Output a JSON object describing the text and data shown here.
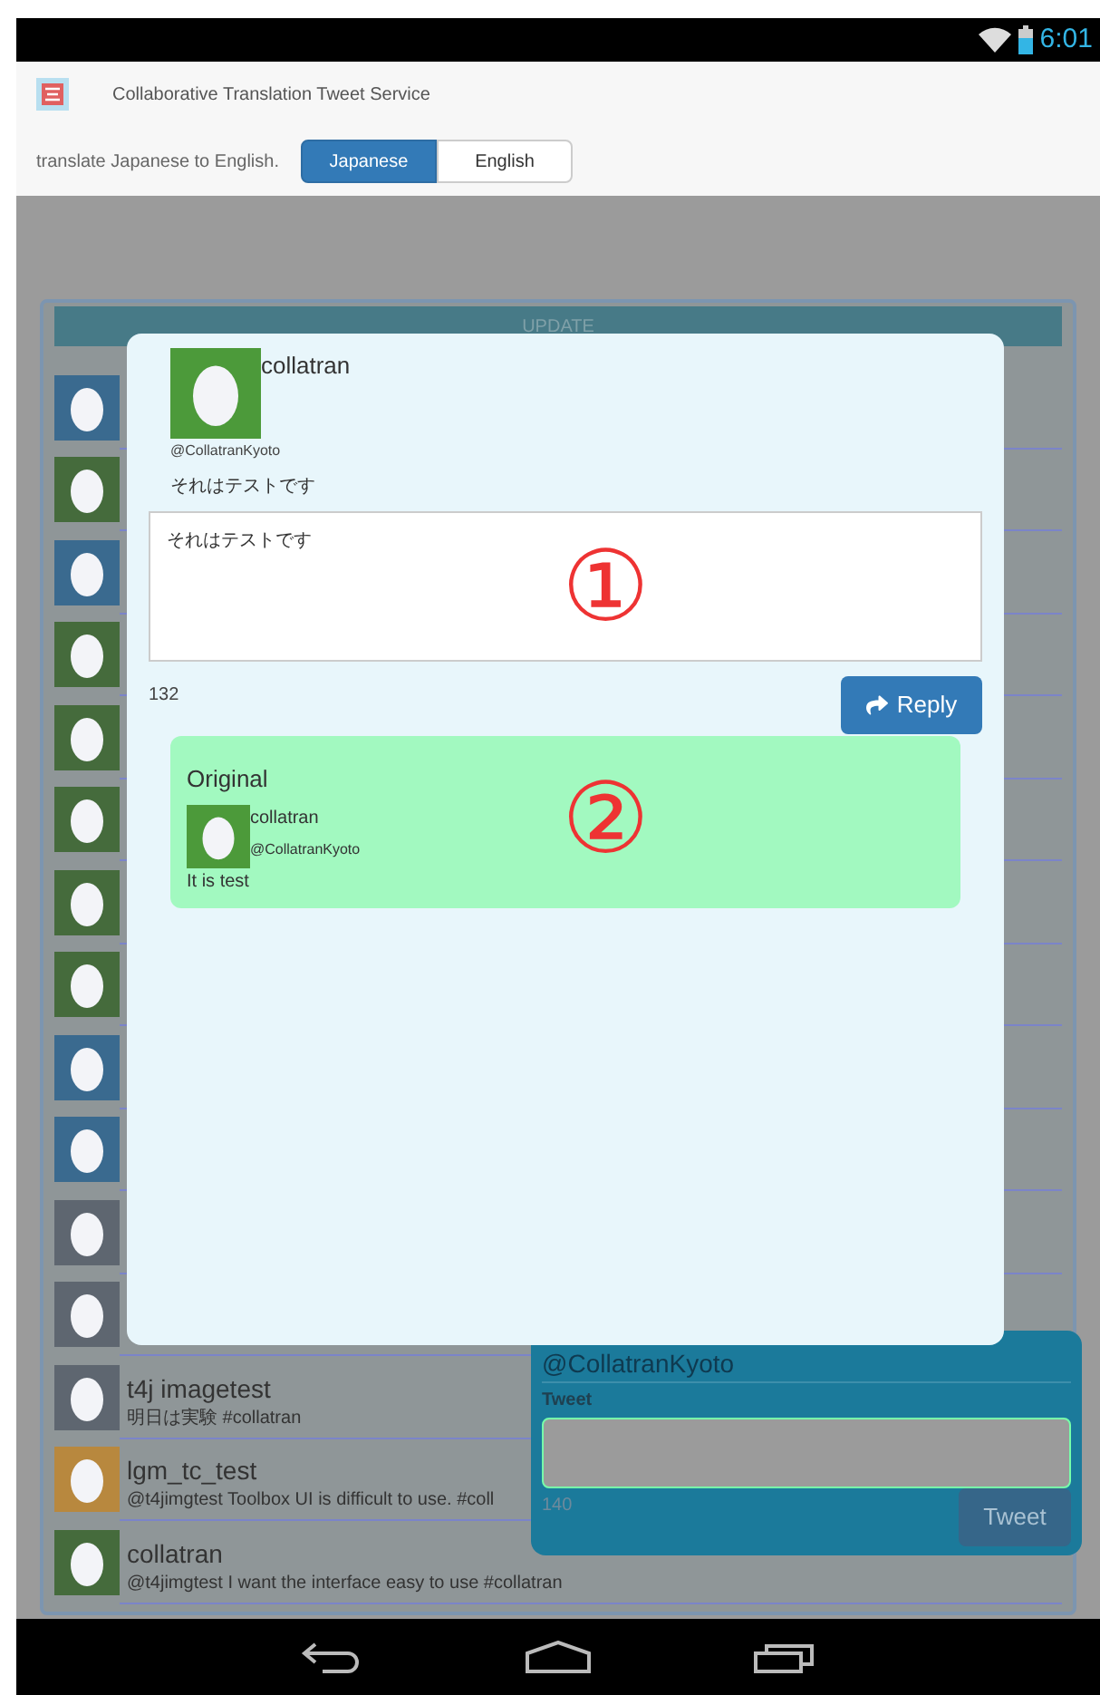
{
  "status_bar": {
    "time": "6:01"
  },
  "app": {
    "title": "Collaborative Translation Tweet Service"
  },
  "language_bar": {
    "label": "translate Japanese to English.",
    "options": [
      {
        "label": "Japanese",
        "selected": true
      },
      {
        "label": "English",
        "selected": false
      }
    ]
  },
  "timeline": {
    "update_button": "UPDATE",
    "tweets": [
      {
        "color": "#3a6a8f"
      },
      {
        "color": "#456b3c"
      },
      {
        "color": "#3a6a8f"
      },
      {
        "color": "#456b3c"
      },
      {
        "color": "#456b3c"
      },
      {
        "color": "#456b3c"
      },
      {
        "color": "#456b3c"
      },
      {
        "color": "#456b3c"
      },
      {
        "color": "#3a6a8f"
      },
      {
        "color": "#3a6a8f"
      },
      {
        "color": "#5e6670"
      },
      {
        "color": "#5e6670"
      },
      {
        "color": "#5e6670",
        "name": "t4j imagetest",
        "text": "明日は実験 #collatran"
      },
      {
        "color": "#b8883e",
        "name": "lgm_tc_test",
        "text": "@t4jimgtest Toolbox UI is difficult to use. #coll"
      },
      {
        "color": "#456b3c",
        "name": "collatran",
        "text": "@t4jimgtest I want the interface easy to use #collatran"
      }
    ]
  },
  "tweet_panel": {
    "account": "@CollatranKyoto",
    "label": "Tweet",
    "counter": "140",
    "button": "Tweet"
  },
  "reply_dialog": {
    "name": "collatran",
    "handle": "@CollatranKyoto",
    "text": "それはテストです",
    "reply_value": "それはテストです",
    "annotation": "①",
    "counter": "132",
    "button": "Reply",
    "original": {
      "heading": "Original",
      "name": "collatran",
      "handle": "@CollatranKyoto",
      "text": "It is test",
      "annotation": "②"
    }
  }
}
